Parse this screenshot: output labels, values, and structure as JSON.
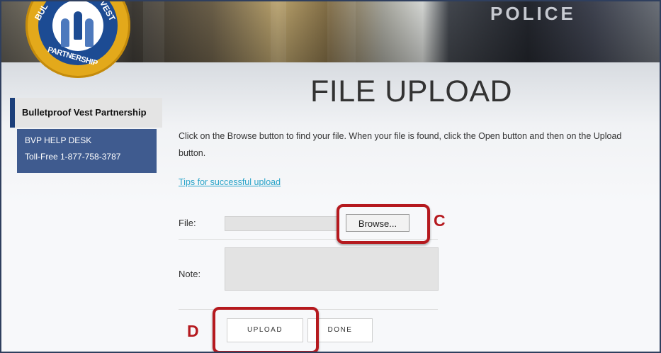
{
  "header": {
    "banner_text": "POLICE",
    "logo": {
      "text_top_left": "BUL",
      "text_top_right": "VEST",
      "text_bottom": "PARTNERSHIP",
      "colors": {
        "ring": "#e3a91b",
        "inner": "#1c4b93"
      }
    }
  },
  "sidebar": {
    "title": "Bulletproof Vest Partnership",
    "help_desk_label": "BVP HELP DESK",
    "toll_free": "Toll-Free 1-877-758-3787"
  },
  "main": {
    "title": "FILE UPLOAD",
    "instructions": "Click on the Browse button to find your file. When your file is found, click the Open button and then on the Upload button.",
    "tips_link": "Tips for successful upload",
    "file_label": "File:",
    "browse_label": "Browse...",
    "note_label": "Note:",
    "upload_label": "UPLOAD",
    "done_label": "DONE"
  },
  "annotations": {
    "c_label": "C",
    "d_label": "D",
    "color": "#b5191e"
  }
}
